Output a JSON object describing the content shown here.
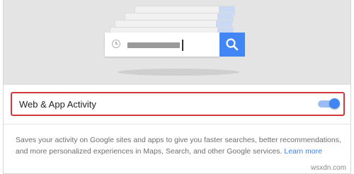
{
  "setting": {
    "title": "Web & App Activity",
    "toggle_on": true
  },
  "description": {
    "text": "Saves your activity on Google sites and apps to give you faster searches, better recommendations, and more personalized experiences in Maps, Search, and other Google services.",
    "link_label": "Learn more"
  },
  "watermark": "wsxdn.com",
  "colors": {
    "accent": "#4285f4",
    "highlight_border": "#d0393e",
    "link": "#3d7fe0"
  }
}
